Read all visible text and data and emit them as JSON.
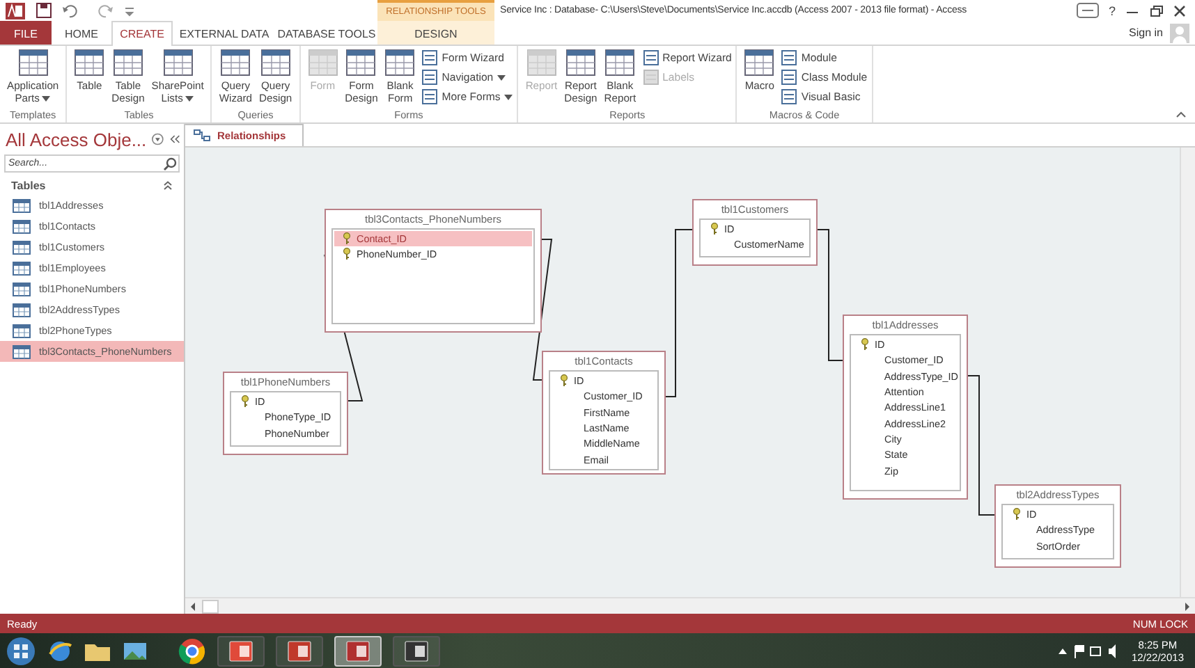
{
  "window": {
    "title": "Service Inc : Database- C:\\Users\\Steve\\Documents\\Service Inc.accdb (Access 2007 - 2013 file format) - Access",
    "contextual_group": "RELATIONSHIP TOOLS",
    "help": "?",
    "sign_in": "Sign in"
  },
  "ribbon_tabs": [
    {
      "label": "FILE",
      "kind": "file",
      "selected": false
    },
    {
      "label": "HOME",
      "kind": "normal",
      "selected": false
    },
    {
      "label": "CREATE",
      "kind": "normal",
      "selected": true
    },
    {
      "label": "EXTERNAL DATA",
      "kind": "normal",
      "selected": false
    },
    {
      "label": "DATABASE TOOLS",
      "kind": "normal",
      "selected": false
    },
    {
      "label": "DESIGN",
      "kind": "contextual",
      "selected": false
    }
  ],
  "ribbon_groups": [
    {
      "label": "Templates",
      "items": [
        {
          "kind": "large",
          "lines": [
            "Application",
            "Parts"
          ],
          "dropdown": true,
          "disabled": false
        }
      ]
    },
    {
      "label": "Tables",
      "items": [
        {
          "kind": "large",
          "lines": [
            "Table"
          ],
          "dropdown": false,
          "disabled": false
        },
        {
          "kind": "large",
          "lines": [
            "Table",
            "Design"
          ],
          "dropdown": false,
          "disabled": false
        },
        {
          "kind": "large",
          "lines": [
            "SharePoint",
            "Lists"
          ],
          "dropdown": true,
          "disabled": false
        }
      ]
    },
    {
      "label": "Queries",
      "items": [
        {
          "kind": "large",
          "lines": [
            "Query",
            "Wizard"
          ],
          "dropdown": false,
          "disabled": false
        },
        {
          "kind": "large",
          "lines": [
            "Query",
            "Design"
          ],
          "dropdown": false,
          "disabled": false
        }
      ]
    },
    {
      "label": "Forms",
      "items": [
        {
          "kind": "large",
          "lines": [
            "Form"
          ],
          "dropdown": false,
          "disabled": true
        },
        {
          "kind": "large",
          "lines": [
            "Form",
            "Design"
          ],
          "dropdown": false,
          "disabled": false
        },
        {
          "kind": "large",
          "lines": [
            "Blank",
            "Form"
          ],
          "dropdown": false,
          "disabled": false
        },
        {
          "kind": "small",
          "lines": [
            "Form Wizard"
          ],
          "dropdown": false,
          "disabled": false
        },
        {
          "kind": "small",
          "lines": [
            "Navigation"
          ],
          "dropdown": true,
          "disabled": false
        },
        {
          "kind": "small",
          "lines": [
            "More Forms"
          ],
          "dropdown": true,
          "disabled": false
        }
      ]
    },
    {
      "label": "Reports",
      "items": [
        {
          "kind": "large",
          "lines": [
            "Report"
          ],
          "dropdown": false,
          "disabled": true
        },
        {
          "kind": "large",
          "lines": [
            "Report",
            "Design"
          ],
          "dropdown": false,
          "disabled": false
        },
        {
          "kind": "large",
          "lines": [
            "Blank",
            "Report"
          ],
          "dropdown": false,
          "disabled": false
        },
        {
          "kind": "small",
          "lines": [
            "Report Wizard"
          ],
          "dropdown": false,
          "disabled": false
        },
        {
          "kind": "small",
          "lines": [
            "Labels"
          ],
          "dropdown": false,
          "disabled": true
        }
      ]
    },
    {
      "label": "Macros & Code",
      "items": [
        {
          "kind": "large",
          "lines": [
            "Macro"
          ],
          "dropdown": false,
          "disabled": false
        },
        {
          "kind": "small",
          "lines": [
            "Module"
          ],
          "dropdown": false,
          "disabled": false
        },
        {
          "kind": "small",
          "lines": [
            "Class Module"
          ],
          "dropdown": false,
          "disabled": false
        },
        {
          "kind": "small",
          "lines": [
            "Visual Basic"
          ],
          "dropdown": false,
          "disabled": false
        }
      ]
    }
  ],
  "nav_pane": {
    "title": "All Access Obje...",
    "search": {
      "placeholder": "Search..."
    },
    "section": "Tables",
    "items": [
      {
        "label": "tbl1Addresses",
        "selected": false
      },
      {
        "label": "tbl1Contacts",
        "selected": false
      },
      {
        "label": "tbl1Customers",
        "selected": false
      },
      {
        "label": "tbl1Employees",
        "selected": false
      },
      {
        "label": "tbl1PhoneNumbers",
        "selected": false
      },
      {
        "label": "tbl2AddressTypes",
        "selected": false
      },
      {
        "label": "tbl2PhoneTypes",
        "selected": false
      },
      {
        "label": "tbl3Contacts_PhoneNumbers",
        "selected": true
      }
    ]
  },
  "document_tab": "Relationships",
  "tables": [
    {
      "name": "tbl3Contacts_PhoneNumbers",
      "fields": [
        {
          "name": "Contact_ID",
          "key": true,
          "selected": true
        },
        {
          "name": "PhoneNumber_ID",
          "key": true,
          "selected": false
        }
      ]
    },
    {
      "name": "tbl1PhoneNumbers",
      "fields": [
        {
          "name": "ID",
          "key": true,
          "selected": false
        },
        {
          "name": "PhoneType_ID",
          "key": false,
          "selected": false
        },
        {
          "name": "PhoneNumber",
          "key": false,
          "selected": false
        }
      ]
    },
    {
      "name": "tbl1Contacts",
      "fields": [
        {
          "name": "ID",
          "key": true,
          "selected": false
        },
        {
          "name": "Customer_ID",
          "key": false,
          "selected": false
        },
        {
          "name": "FirstName",
          "key": false,
          "selected": false
        },
        {
          "name": "LastName",
          "key": false,
          "selected": false
        },
        {
          "name": "MiddleName",
          "key": false,
          "selected": false
        },
        {
          "name": "Email",
          "key": false,
          "selected": false
        }
      ]
    },
    {
      "name": "tbl1Customers",
      "fields": [
        {
          "name": "ID",
          "key": true,
          "selected": false
        },
        {
          "name": "CustomerName",
          "key": false,
          "selected": false
        }
      ]
    },
    {
      "name": "tbl1Addresses",
      "fields": [
        {
          "name": "ID",
          "key": true,
          "selected": false
        },
        {
          "name": "Customer_ID",
          "key": false,
          "selected": false
        },
        {
          "name": "AddressType_ID",
          "key": false,
          "selected": false
        },
        {
          "name": "Attention",
          "key": false,
          "selected": false
        },
        {
          "name": "AddressLine1",
          "key": false,
          "selected": false
        },
        {
          "name": "AddressLine2",
          "key": false,
          "selected": false
        },
        {
          "name": "City",
          "key": false,
          "selected": false
        },
        {
          "name": "State",
          "key": false,
          "selected": false
        },
        {
          "name": "Zip",
          "key": false,
          "selected": false
        }
      ]
    },
    {
      "name": "tbl2AddressTypes",
      "fields": [
        {
          "name": "ID",
          "key": true,
          "selected": false
        },
        {
          "name": "AddressType",
          "key": false,
          "selected": false
        },
        {
          "name": "SortOrder",
          "key": false,
          "selected": false
        }
      ]
    }
  ],
  "status_bar": {
    "left": "Ready",
    "right": "NUM LOCK"
  },
  "taskbar": {
    "apps": [
      {
        "selected": false
      },
      {
        "selected": false
      },
      {
        "selected": true
      },
      {
        "selected": false
      }
    ],
    "time": "8:25 PM",
    "date": "12/22/2013"
  }
}
